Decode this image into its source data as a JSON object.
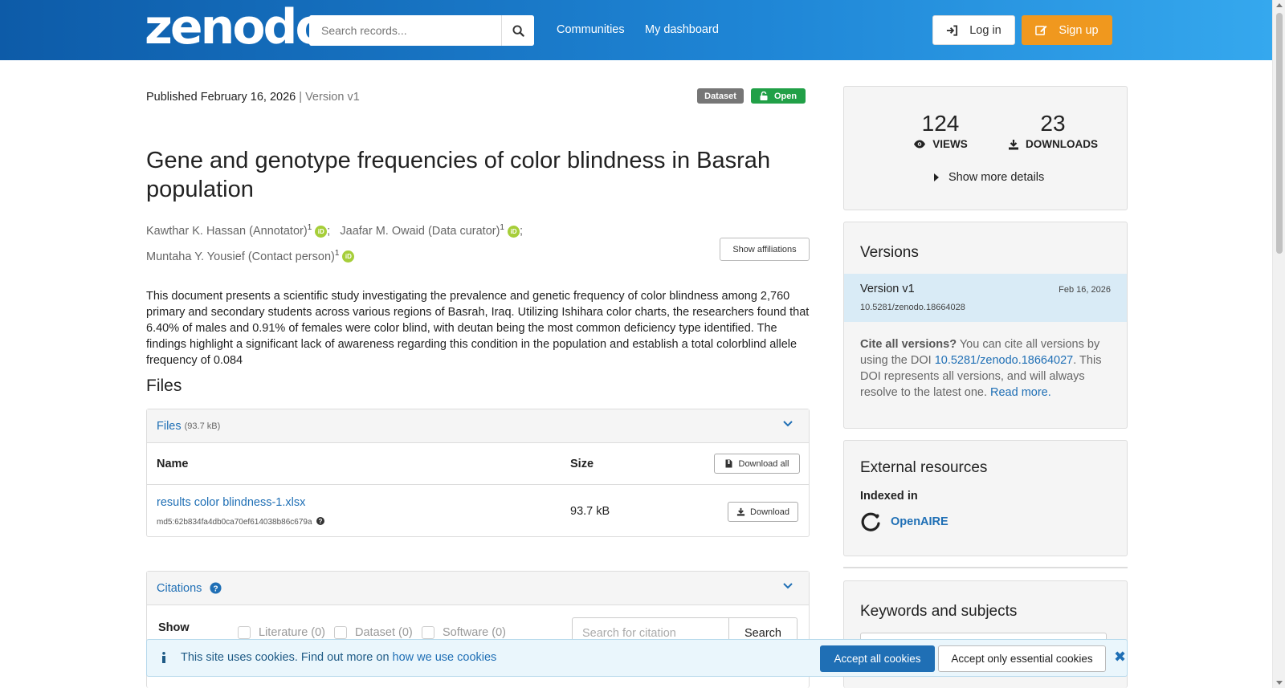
{
  "header": {
    "logo_text": "zenodo",
    "search_placeholder": "Search records...",
    "nav": [
      "Communities",
      "My dashboard"
    ],
    "login_label": "Log in",
    "signup_label": "Sign up"
  },
  "record": {
    "published_prefix": "Published",
    "published_date": "February 16, 2026",
    "version_text": "Version v1",
    "badge_type": "Dataset",
    "badge_access": "Open",
    "title": "Gene and genotype frequencies of color blindness in Basrah population",
    "creators": [
      {
        "name": "Kawthar K. Hassan (Annotator)",
        "aff": "1"
      },
      {
        "name": "Jaafar M. Owaid (Data curator)",
        "aff": "1"
      },
      {
        "name": "Muntaha Y. Yousief (Contact person)",
        "aff": "1"
      }
    ],
    "show_affiliations": "Show affiliations",
    "description": "This document presents a scientific study investigating the prevalence and genetic frequency of color blindness among 2,760 primary and secondary students across various regions of Basrah, Iraq. Utilizing Ishihara color charts, the researchers found that 6.40% of males and 0.91% of females were color blind, with deutan being the most common deficiency type identified. The findings highlight a significant lack of awareness regarding this condition in the population and establish a total colorblind allele frequency of 0.084"
  },
  "files": {
    "section_title": "Files",
    "panel_title": "Files",
    "total_size": "(93.7 kB)",
    "col_name": "Name",
    "col_size": "Size",
    "download_all": "Download all",
    "items": [
      {
        "name": "results color blindness-1.xlsx",
        "md5": "md5:62b834fa4db0ca70ef614038b86c679a",
        "size": "93.7 kB",
        "download": "Download"
      }
    ]
  },
  "citations": {
    "panel_title": "Citations",
    "show_label": "Show",
    "filters": [
      "Literature (0)",
      "Dataset (0)",
      "Software (0)"
    ],
    "search_placeholder": "Search for citation",
    "search_button": "Search"
  },
  "stats": {
    "views": "124",
    "views_label": "VIEWS",
    "downloads": "23",
    "downloads_label": "DOWNLOADS",
    "more_details": "Show more details"
  },
  "versions": {
    "title": "Versions",
    "item_name": "Version v1",
    "item_date": "Feb 16, 2026",
    "item_doi": "10.5281/zenodo.18664028",
    "cite_bold": "Cite all versions?",
    "cite_text_1": " You can cite all versions by using the DOI ",
    "cite_doi": "10.5281/zenodo.18664027",
    "cite_text_2": ". This DOI represents all versions, and will always resolve to the latest one. ",
    "read_more": "Read more."
  },
  "external": {
    "title": "External resources",
    "indexed_in": "Indexed in",
    "openaire": "OpenAIRE"
  },
  "keywords": {
    "title": "Keywords and subjects"
  },
  "cookie": {
    "text": "This site uses cookies. Find out more on",
    "link": "how we use cookies",
    "accept_all": "Accept all cookies",
    "accept_essential": "Accept only essential cookies"
  },
  "colors": {
    "header_start": "#0d5ba8",
    "header_end": "#35a8ee",
    "signup": "#f0981e",
    "open_badge": "#21a047",
    "link": "#1f6fb5"
  }
}
